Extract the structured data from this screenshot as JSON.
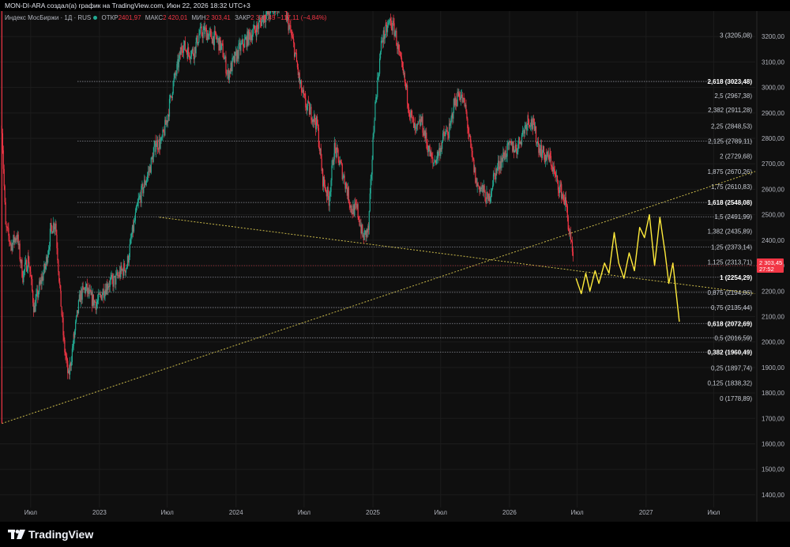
{
  "header": {
    "attribution": "MON-DI-ARA создал(а) график на TradingView.com, Июн 22, 2026 18:32 UTC+3"
  },
  "legend": {
    "symbol": "Индекс МосБиржи · 1Д · RUS",
    "open_label": "ОТКР",
    "open_value": "2401,97",
    "high_label": "МАКС",
    "high_value": "2 420,01",
    "low_label": "МИН",
    "low_value": "2 303,41",
    "close_label": "ЗАКР",
    "close_value": "2 303,45 −117,11 (−4,84%)"
  },
  "price_badge": {
    "price": "2 303,45",
    "countdown": "27:52",
    "color": "#f23645"
  },
  "footer": {
    "logo_text": "TradingView"
  },
  "colors": {
    "bull": "#22ab94",
    "bear": "#f23645",
    "projection": "#ffeb3b",
    "trendline": "#c9b94a",
    "fib": "#8a8d96"
  },
  "chart_data": {
    "type": "line",
    "y_axis": {
      "ticks": [
        3200,
        3100,
        3000,
        2900,
        2800,
        2700,
        2600,
        2500,
        2400,
        2300,
        2200,
        2100,
        2000,
        1900,
        1800,
        1700,
        1600,
        1500,
        1400
      ],
      "tick_labels": [
        "3200,00",
        "3100,00",
        "3000,00",
        "2900,00",
        "2800,00",
        "2700,00",
        "2600,00",
        "2500,00",
        "2400,00",
        "2300,00",
        "2200,00",
        "2100,00",
        "2000,00",
        "1900,00",
        "1800,00",
        "1700,00",
        "1600,00",
        "1500,00",
        "1400,00"
      ],
      "ylim": [
        1350,
        3300
      ]
    },
    "x_axis": {
      "ticks": [
        "2022-07-01",
        "2023-01-01",
        "2023-07-01",
        "2024-01-01",
        "2024-07-01",
        "2025-01-01",
        "2025-07-01",
        "2026-01-01",
        "2026-07-01",
        "2027-01-01",
        "2027-07-01"
      ],
      "tick_labels": [
        "Июл",
        "2023",
        "Июл",
        "2024",
        "Июл",
        "2025",
        "Июл",
        "2026",
        "Июл",
        "2027",
        "Июл"
      ],
      "xlim": [
        "2022-04-10",
        "2027-10-20"
      ]
    },
    "fib_levels": [
      {
        "ratio": "3",
        "value": 3205.08,
        "label": "3 (3205,08)",
        "bold": false,
        "line": false
      },
      {
        "ratio": "2,618",
        "value": 3023.48,
        "label": "2,618 (3023,48)",
        "bold": true,
        "line": true
      },
      {
        "ratio": "2,5",
        "value": 2967.38,
        "label": "2,5 (2967,38)",
        "bold": false,
        "line": false
      },
      {
        "ratio": "2,382",
        "value": 2911.28,
        "label": "2,382 (2911,28)",
        "bold": false,
        "line": false
      },
      {
        "ratio": "2,25",
        "value": 2848.53,
        "label": "2,25 (2848,53)",
        "bold": false,
        "line": false
      },
      {
        "ratio": "2,125",
        "value": 2789.11,
        "label": "2,125 (2789,11)",
        "bold": false,
        "line": true
      },
      {
        "ratio": "2",
        "value": 2729.68,
        "label": "2 (2729,68)",
        "bold": false,
        "line": false
      },
      {
        "ratio": "1,875",
        "value": 2670.26,
        "label": "1,875 (2670,26)",
        "bold": false,
        "line": false
      },
      {
        "ratio": "1,75",
        "value": 2610.83,
        "label": "1,75 (2610,83)",
        "bold": false,
        "line": false
      },
      {
        "ratio": "1,618",
        "value": 2548.08,
        "label": "1,618 (2548,08)",
        "bold": true,
        "line": true
      },
      {
        "ratio": "1,5",
        "value": 2491.99,
        "label": "1,5 (2491,99)",
        "bold": false,
        "line": true
      },
      {
        "ratio": "1,382",
        "value": 2435.89,
        "label": "1,382 (2435,89)",
        "bold": false,
        "line": false
      },
      {
        "ratio": "1,25",
        "value": 2373.14,
        "label": "1,25 (2373,14)",
        "bold": false,
        "line": true
      },
      {
        "ratio": "1,125",
        "value": 2313.71,
        "label": "1,125 (2313,71)",
        "bold": false,
        "line": false
      },
      {
        "ratio": "1",
        "value": 2254.29,
        "label": "1 (2254,29)",
        "bold": true,
        "line": true
      },
      {
        "ratio": "0,875",
        "value": 2194.86,
        "label": "0,875 (2194,86)",
        "bold": false,
        "line": true
      },
      {
        "ratio": "0,75",
        "value": 2135.44,
        "label": "0,75 (2135,44)",
        "bold": false,
        "line": true
      },
      {
        "ratio": "0,618",
        "value": 2072.69,
        "label": "0,618 (2072,69)",
        "bold": true,
        "line": true
      },
      {
        "ratio": "0,5",
        "value": 2016.59,
        "label": "0,5 (2016,59)",
        "bold": false,
        "line": true
      },
      {
        "ratio": "0,382",
        "value": 1960.49,
        "label": "0,382 (1960,49)",
        "bold": true,
        "line": true
      },
      {
        "ratio": "0,25",
        "value": 1897.74,
        "label": "0,25 (1897,74)",
        "bold": false,
        "line": false
      },
      {
        "ratio": "0,125",
        "value": 1838.32,
        "label": "0,125 (1838,32)",
        "bold": false,
        "line": false
      },
      {
        "ratio": "0",
        "value": 1778.89,
        "label": "0 (1778,89)",
        "bold": false,
        "line": false
      }
    ],
    "trendlines": [
      {
        "from": [
          "2022-04-15",
          1680
        ],
        "to": [
          "2027-10-20",
          2670
        ]
      },
      {
        "from": [
          "2023-06-10",
          2490
        ],
        "to": [
          "2027-10-20",
          2190
        ]
      }
    ],
    "price_path": [
      [
        "2022-04-15",
        2850
      ],
      [
        "2022-04-25",
        2450
      ],
      [
        "2022-05-10",
        2380
      ],
      [
        "2022-05-25",
        2420
      ],
      [
        "2022-06-10",
        2260
      ],
      [
        "2022-06-25",
        2330
      ],
      [
        "2022-07-10",
        2130
      ],
      [
        "2022-07-25",
        2220
      ],
      [
        "2022-08-10",
        2300
      ],
      [
        "2022-08-25",
        2450
      ],
      [
        "2022-09-05",
        2470
      ],
      [
        "2022-09-20",
        2150
      ],
      [
        "2022-09-28",
        1990
      ],
      [
        "2022-10-10",
        1860
      ],
      [
        "2022-10-25",
        2020
      ],
      [
        "2022-11-10",
        2180
      ],
      [
        "2022-11-25",
        2210
      ],
      [
        "2022-12-10",
        2170
      ],
      [
        "2022-12-25",
        2150
      ],
      [
        "2023-01-10",
        2200
      ],
      [
        "2023-01-25",
        2230
      ],
      [
        "2023-02-10",
        2240
      ],
      [
        "2023-02-25",
        2270
      ],
      [
        "2023-03-15",
        2300
      ],
      [
        "2023-03-30",
        2430
      ],
      [
        "2023-04-15",
        2550
      ],
      [
        "2023-05-01",
        2620
      ],
      [
        "2023-05-15",
        2680
      ],
      [
        "2023-06-01",
        2780
      ],
      [
        "2023-06-15",
        2780
      ],
      [
        "2023-07-01",
        2880
      ],
      [
        "2023-07-15",
        3000
      ],
      [
        "2023-08-01",
        3100
      ],
      [
        "2023-08-10",
        3170
      ],
      [
        "2023-08-25",
        3140
      ],
      [
        "2023-09-10",
        3140
      ],
      [
        "2023-09-25",
        3210
      ],
      [
        "2023-10-10",
        3220
      ],
      [
        "2023-10-25",
        3200
      ],
      [
        "2023-11-10",
        3190
      ],
      [
        "2023-11-25",
        3150
      ],
      [
        "2023-12-10",
        3050
      ],
      [
        "2023-12-25",
        3100
      ],
      [
        "2024-01-10",
        3150
      ],
      [
        "2024-01-25",
        3180
      ],
      [
        "2024-02-10",
        3210
      ],
      [
        "2024-02-25",
        3230
      ],
      [
        "2024-03-15",
        3280
      ],
      [
        "2024-03-30",
        3290
      ],
      [
        "2024-04-15",
        3320
      ],
      [
        "2024-05-05",
        3330
      ],
      [
        "2024-05-20",
        3250
      ],
      [
        "2024-06-05",
        3150
      ],
      [
        "2024-06-20",
        3010
      ],
      [
        "2024-07-05",
        2930
      ],
      [
        "2024-07-20",
        2900
      ],
      [
        "2024-08-05",
        2850
      ],
      [
        "2024-08-20",
        2640
      ],
      [
        "2024-09-05",
        2560
      ],
      [
        "2024-09-20",
        2760
      ],
      [
        "2024-10-05",
        2700
      ],
      [
        "2024-10-20",
        2620
      ],
      [
        "2024-11-05",
        2520
      ],
      [
        "2024-11-20",
        2520
      ],
      [
        "2024-12-05",
        2410
      ],
      [
        "2024-12-20",
        2440
      ],
      [
        "2025-01-05",
        2900
      ],
      [
        "2025-01-15",
        3050
      ],
      [
        "2025-01-25",
        3190
      ],
      [
        "2025-02-05",
        3220
      ],
      [
        "2025-02-15",
        3260
      ],
      [
        "2025-03-01",
        3220
      ],
      [
        "2025-03-15",
        3100
      ],
      [
        "2025-03-30",
        3000
      ],
      [
        "2025-04-10",
        2900
      ],
      [
        "2025-04-25",
        2820
      ],
      [
        "2025-05-10",
        2870
      ],
      [
        "2025-05-25",
        2780
      ],
      [
        "2025-06-10",
        2700
      ],
      [
        "2025-06-25",
        2740
      ],
      [
        "2025-07-10",
        2810
      ],
      [
        "2025-07-25",
        2830
      ],
      [
        "2025-08-05",
        2930
      ],
      [
        "2025-08-20",
        2980
      ],
      [
        "2025-09-05",
        2920
      ],
      [
        "2025-09-20",
        2750
      ],
      [
        "2025-10-05",
        2620
      ],
      [
        "2025-10-20",
        2600
      ],
      [
        "2025-11-05",
        2550
      ],
      [
        "2025-11-20",
        2650
      ],
      [
        "2025-12-05",
        2700
      ],
      [
        "2025-12-20",
        2740
      ],
      [
        "2026-01-05",
        2770
      ],
      [
        "2026-01-20",
        2760
      ],
      [
        "2026-02-05",
        2820
      ],
      [
        "2026-02-20",
        2880
      ],
      [
        "2026-03-05",
        2850
      ],
      [
        "2026-03-20",
        2770
      ],
      [
        "2026-04-05",
        2730
      ],
      [
        "2026-04-20",
        2720
      ],
      [
        "2026-05-05",
        2640
      ],
      [
        "2026-05-20",
        2590
      ],
      [
        "2026-06-01",
        2540
      ],
      [
        "2026-06-10",
        2430
      ],
      [
        "2026-06-22",
        2300
      ]
    ],
    "projection": [
      [
        "2026-06-28",
        2250
      ],
      [
        "2026-07-12",
        2190
      ],
      [
        "2026-07-24",
        2270
      ],
      [
        "2026-08-04",
        2200
      ],
      [
        "2026-08-18",
        2280
      ],
      [
        "2026-08-28",
        2230
      ],
      [
        "2026-09-12",
        2310
      ],
      [
        "2026-09-24",
        2270
      ],
      [
        "2026-10-08",
        2430
      ],
      [
        "2026-10-20",
        2310
      ],
      [
        "2026-11-03",
        2250
      ],
      [
        "2026-11-17",
        2350
      ],
      [
        "2026-12-01",
        2280
      ],
      [
        "2026-12-15",
        2450
      ],
      [
        "2026-12-28",
        2410
      ],
      [
        "2027-01-10",
        2500
      ],
      [
        "2027-01-24",
        2300
      ],
      [
        "2027-02-07",
        2490
      ],
      [
        "2027-02-21",
        2350
      ],
      [
        "2027-03-03",
        2230
      ],
      [
        "2027-03-14",
        2310
      ],
      [
        "2027-03-31",
        2080
      ]
    ]
  }
}
